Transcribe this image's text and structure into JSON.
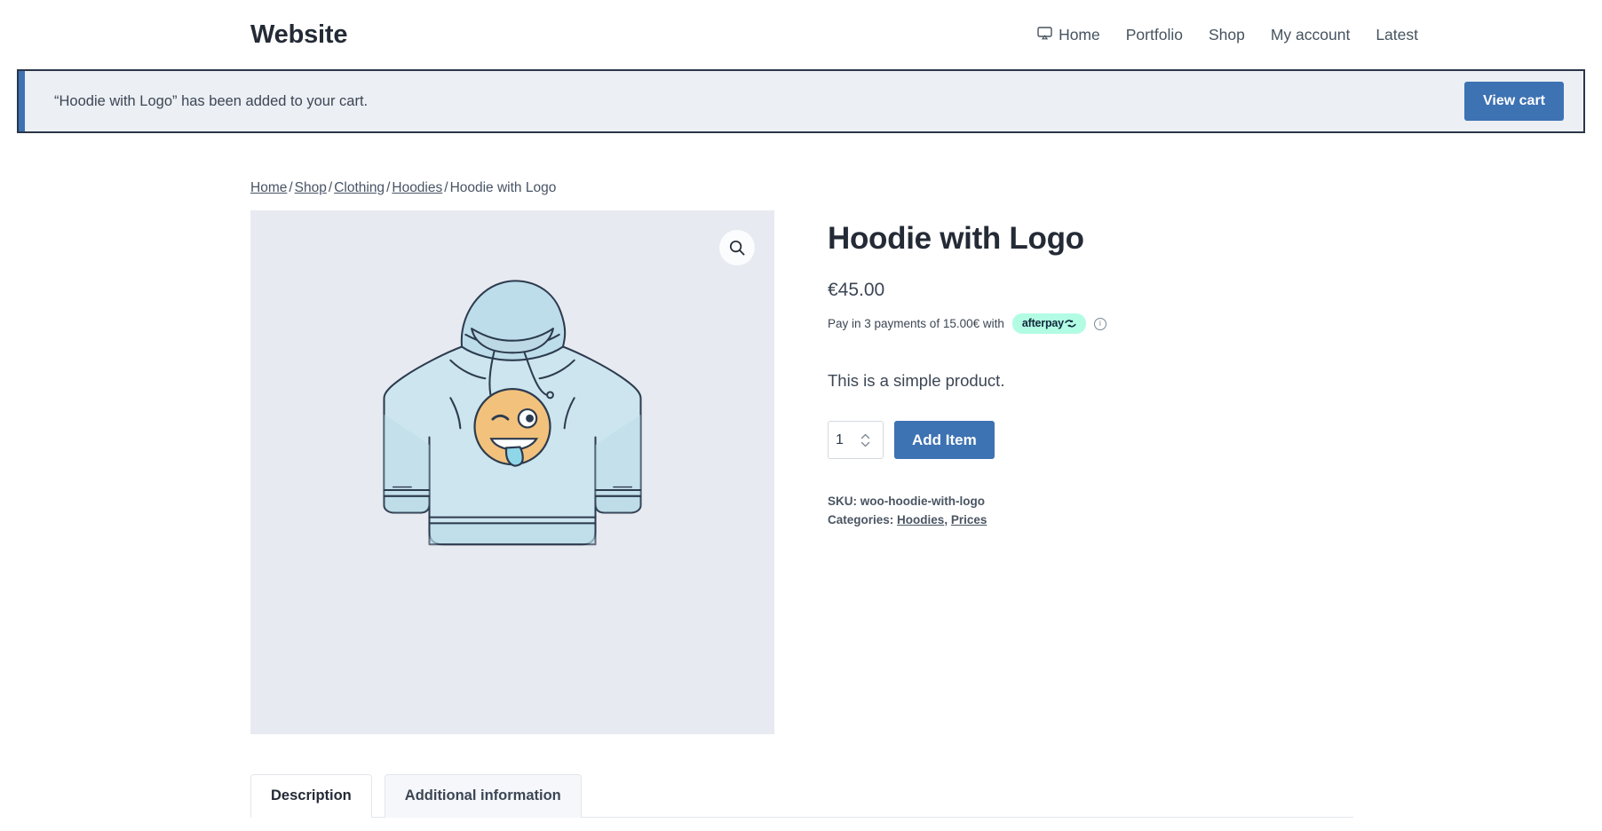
{
  "header": {
    "brand": "Website",
    "nav": [
      {
        "label": "Home",
        "icon": "monitor-icon"
      },
      {
        "label": "Portfolio",
        "icon": ""
      },
      {
        "label": "Shop",
        "icon": ""
      },
      {
        "label": "My account",
        "icon": ""
      },
      {
        "label": "Latest",
        "icon": ""
      }
    ]
  },
  "notice": {
    "message": "“Hoodie with Logo” has been added to your cart.",
    "action_label": "View cart",
    "accent_color": "#3d72b3",
    "background_color": "#eceff4",
    "outline_color": "#2b3648"
  },
  "breadcrumb": {
    "items": [
      {
        "label": "Home",
        "link": true
      },
      {
        "label": "Shop",
        "link": true
      },
      {
        "label": "Clothing",
        "link": true
      },
      {
        "label": "Hoodies",
        "link": true
      },
      {
        "label": "Hoodie with Logo",
        "link": false
      }
    ],
    "separator": "/"
  },
  "gallery": {
    "zoom_icon": "search-icon",
    "background_color": "#e7eaf0",
    "product_image_alt": "Light blue hoodie with winking emoji logo"
  },
  "product": {
    "title": "Hoodie with Logo",
    "price": "€45.00",
    "installments_prefix": "Pay in 3 payments of 15.00€ with",
    "installments_brand": "afterpay",
    "installments_info_icon": "info-icon",
    "short_description": "This is a simple product.",
    "quantity_value": "1",
    "quantity_placeholder": "1",
    "add_to_cart_label": "Add Item",
    "sku_label": "SKU:",
    "sku_value": "woo-hoodie-with-logo",
    "categories_label": "Categories:",
    "categories": [
      "Hoodies",
      "Prices"
    ],
    "categories_separator": ", ",
    "accent_color": "#3d72b3",
    "afterpay_badge_color": "#b2fce4"
  },
  "tabs": [
    {
      "label": "Description",
      "active": true
    },
    {
      "label": "Additional information",
      "active": false
    }
  ]
}
